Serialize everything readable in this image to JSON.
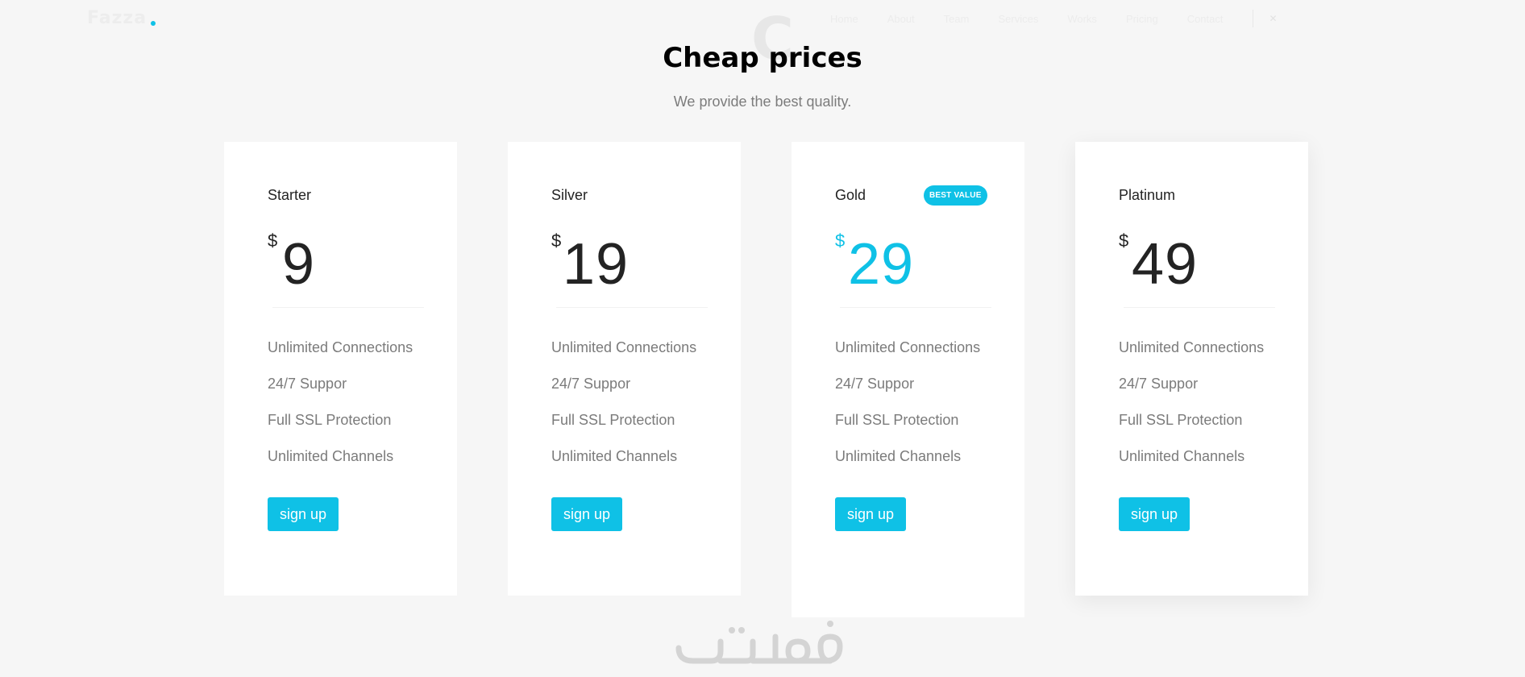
{
  "nav": {
    "logo": "Fazza",
    "items": [
      "Home",
      "About",
      "Team",
      "Services",
      "Works",
      "Pricing",
      "Contact"
    ]
  },
  "heading": {
    "bg_letter": "C",
    "title": "Cheap prices",
    "subtitle": "We provide the best quality."
  },
  "accent_color": "#0fc1e6",
  "plans": [
    {
      "name": "Starter",
      "currency": "$",
      "price": "9",
      "features": [
        "Unlimited Connections",
        "24/7 Suppor",
        "Full SSL Protection",
        "Unlimited Channels"
      ],
      "button": "sign up"
    },
    {
      "name": "Silver",
      "currency": "$",
      "price": "19",
      "features": [
        "Unlimited Connections",
        "24/7 Suppor",
        "Full SSL Protection",
        "Unlimited Channels"
      ],
      "button": "sign up"
    },
    {
      "name": "Gold",
      "badge": "BEST VALUE",
      "currency": "$",
      "price": "29",
      "features": [
        "Unlimited Connections",
        "24/7 Suppor",
        "Full SSL Protection",
        "Unlimited Channels"
      ],
      "button": "sign up"
    },
    {
      "name": "Platinum",
      "currency": "$",
      "price": "49",
      "features": [
        "Unlimited Connections",
        "24/7 Suppor",
        "Full SSL Protection",
        "Unlimited Channels"
      ],
      "button": "sign up"
    }
  ],
  "watermark": "خمسات"
}
